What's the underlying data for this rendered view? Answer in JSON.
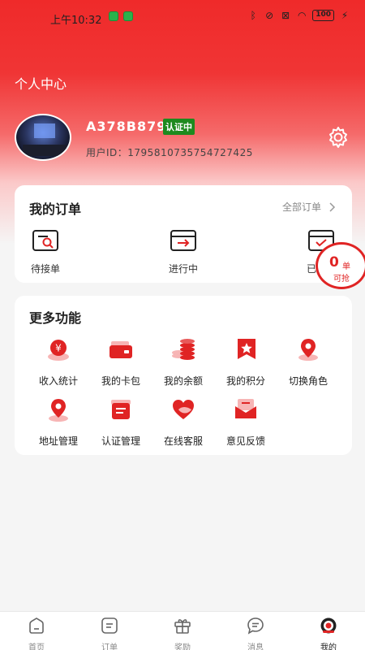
{
  "status_bar": {
    "time": "上午10:32",
    "battery": "100"
  },
  "page": {
    "title": "个人中心"
  },
  "profile": {
    "username": "A378B879",
    "badge": "认证中",
    "user_id": "用户ID：1795810735754727425"
  },
  "orders": {
    "title": "我的订单",
    "all_label": "全部订单",
    "items": [
      {
        "label": "待接单",
        "icon": "search-document-icon"
      },
      {
        "label": "进行中",
        "icon": "inbox-arrow-icon"
      },
      {
        "label": "已完成",
        "icon": "inbox-check-icon"
      }
    ],
    "grab": {
      "count": "0",
      "unit": "单",
      "label": "可抢"
    }
  },
  "more": {
    "title": "更多功能",
    "items": [
      {
        "label": "收入统计",
        "icon": "income-coin-icon"
      },
      {
        "label": "我的卡包",
        "icon": "wallet-card-icon"
      },
      {
        "label": "我的余额",
        "icon": "coin-stack-icon"
      },
      {
        "label": "我的积分",
        "icon": "star-flag-icon"
      },
      {
        "label": "切换角色",
        "icon": "location-pin-icon"
      },
      {
        "label": "地址管理",
        "icon": "address-pin-icon"
      },
      {
        "label": "认证管理",
        "icon": "certificate-icon"
      },
      {
        "label": "在线客服",
        "icon": "heart-chat-icon"
      },
      {
        "label": "意见反馈",
        "icon": "feedback-mail-icon"
      }
    ]
  },
  "tabbar": {
    "items": [
      {
        "label": "首页",
        "icon": "home-icon"
      },
      {
        "label": "订单",
        "icon": "order-list-icon"
      },
      {
        "label": "奖励",
        "icon": "gift-icon"
      },
      {
        "label": "消息",
        "icon": "message-icon"
      },
      {
        "label": "我的",
        "icon": "profile-icon"
      }
    ],
    "active": "我的"
  },
  "colors": {
    "accent": "#e02424",
    "badge_green": "#1e8a1e",
    "header_red": "#ef2a2a"
  }
}
